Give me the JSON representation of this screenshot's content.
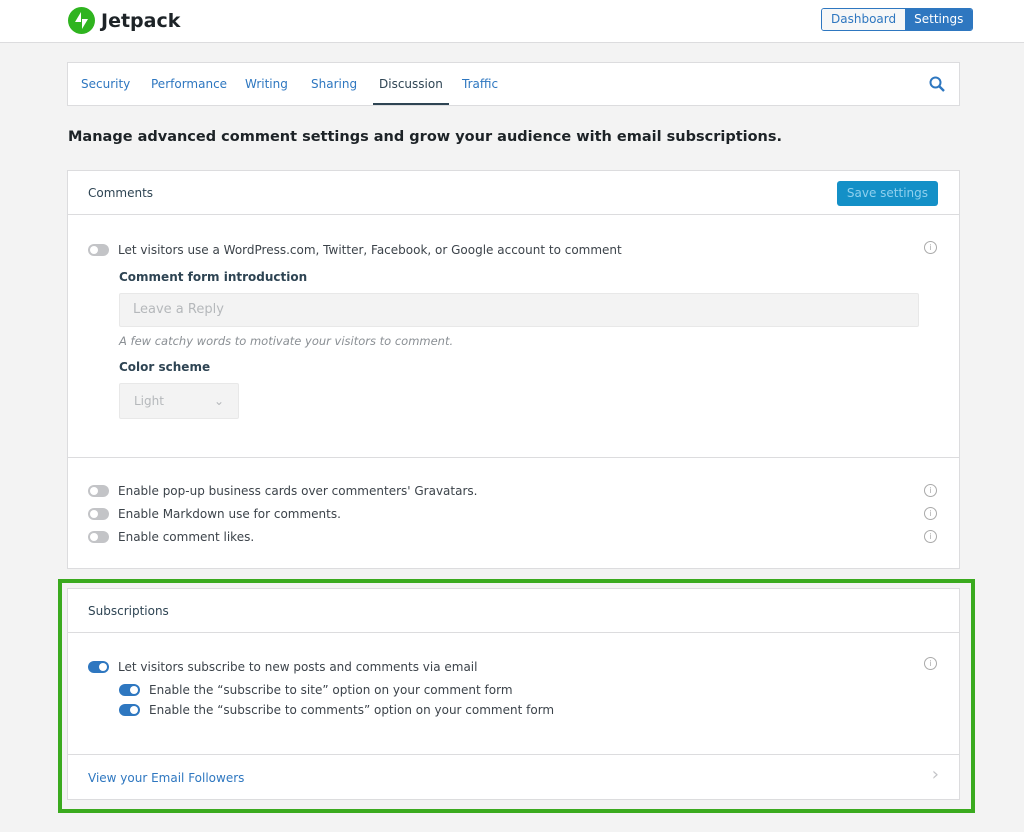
{
  "header": {
    "brand": "Jetpack",
    "buttons": {
      "dashboard": "Dashboard",
      "settings": "Settings"
    }
  },
  "nav": {
    "tabs": [
      {
        "label": "Security"
      },
      {
        "label": "Performance"
      },
      {
        "label": "Writing"
      },
      {
        "label": "Sharing"
      },
      {
        "label": "Discussion",
        "active": true
      },
      {
        "label": "Traffic"
      }
    ],
    "search_icon": "search-icon"
  },
  "lead": "Manage advanced comment settings and grow your audience with email subscriptions.",
  "comments": {
    "title": "Comments",
    "save_label": "Save settings",
    "social_login": {
      "label": "Let visitors use a WordPress.com, Twitter, Facebook, or Google account to comment",
      "on": false
    },
    "intro_label": "Comment form introduction",
    "intro_placeholder": "Leave a Reply",
    "intro_help": "A few catchy words to motivate your visitors to comment.",
    "color_label": "Color scheme",
    "color_value": "Light",
    "toggles": [
      {
        "label": "Enable pop-up business cards over commenters' Gravatars.",
        "on": false
      },
      {
        "label": "Enable Markdown use for comments.",
        "on": false
      },
      {
        "label": "Enable comment likes.",
        "on": false
      }
    ]
  },
  "subscriptions": {
    "title": "Subscriptions",
    "main": {
      "label": "Let visitors subscribe to new posts and comments via email",
      "on": true
    },
    "sub": [
      {
        "label": "Enable the “subscribe to site” option on your comment form",
        "on": true
      },
      {
        "label": "Enable the “subscribe to comments” option on your comment form",
        "on": true
      }
    ],
    "footer_link": "View your Email Followers"
  },
  "colors": {
    "accent": "#2e77c0",
    "highlight": "#3aaa1e",
    "brand": "#2fb41f"
  }
}
